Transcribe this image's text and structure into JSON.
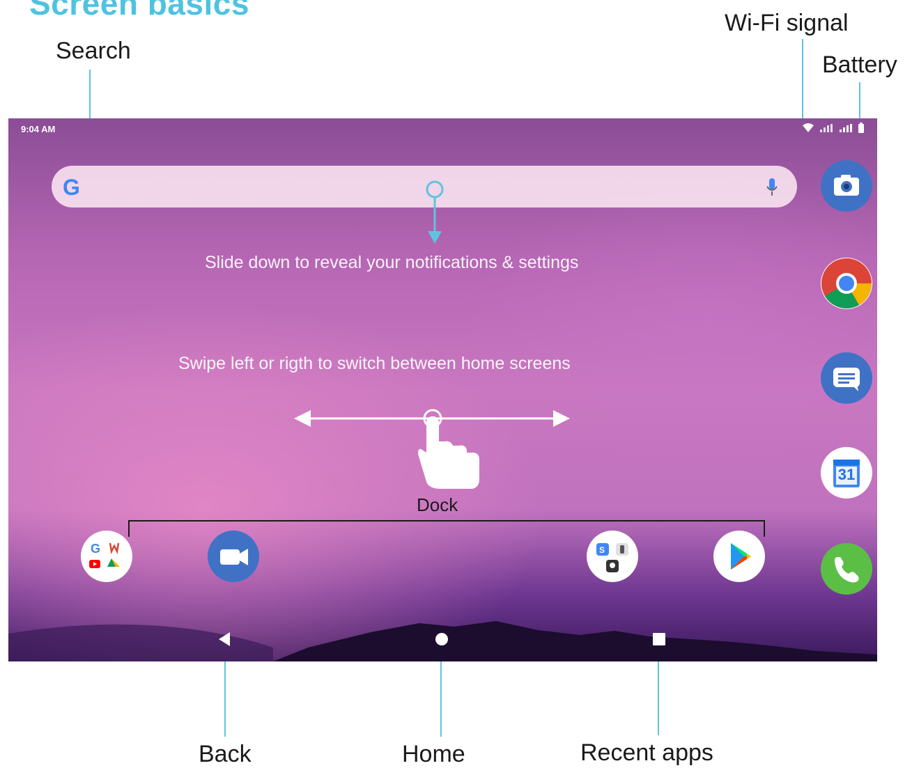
{
  "page_title": "Screen basics",
  "callouts": {
    "search": "Search",
    "wifi": "Wi-Fi signal",
    "battery": "Battery",
    "back": "Back",
    "home": "Home",
    "recent": "Recent apps",
    "dock": "Dock"
  },
  "status_bar": {
    "time": "9:04 AM"
  },
  "search_bar": {
    "logo": "G"
  },
  "hints": {
    "slide_down": "Slide down to reveal your notifications & settings",
    "swipe": "Swipe left or rigth to switch between home screens"
  },
  "side_apps": [
    "camera-icon",
    "chrome-icon",
    "messages-icon",
    "calendar-icon",
    "phone-icon"
  ],
  "calendar_day": "31",
  "dock_apps": [
    "google-folder-icon",
    "duo-icon",
    "folder-icon",
    "play-store-icon"
  ],
  "colors": {
    "accent": "#4ec3e0",
    "callout_line": "#5fc3df"
  }
}
